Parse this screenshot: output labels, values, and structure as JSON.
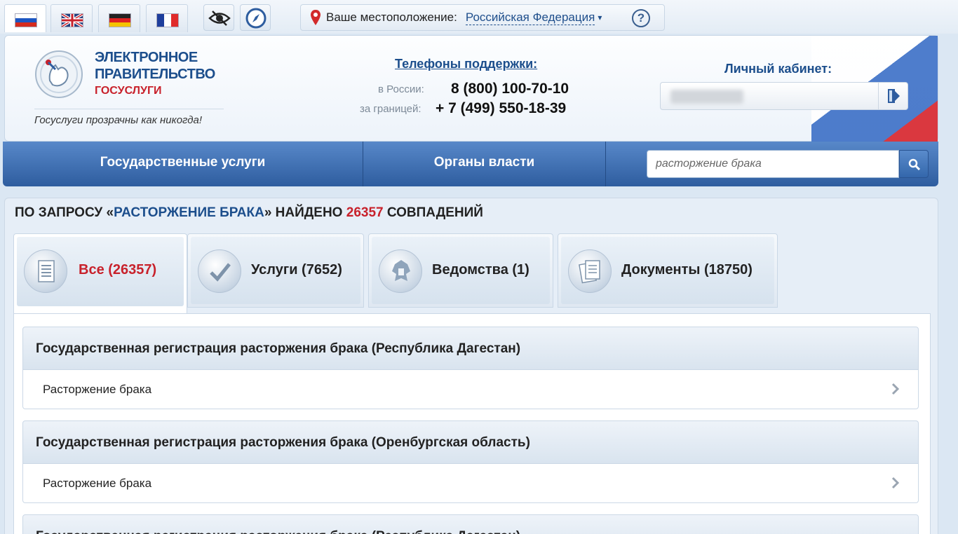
{
  "languages": [
    {
      "name": "ru",
      "active": true
    },
    {
      "name": "en",
      "active": false
    },
    {
      "name": "de",
      "active": false
    },
    {
      "name": "fr",
      "active": false
    }
  ],
  "location": {
    "label": "Ваше местоположение:",
    "value": "Российская Федерация",
    "help": "?"
  },
  "header": {
    "logo_line1": "ЭЛЕКТРОННОЕ",
    "logo_line2": "ПРАВИТЕЛЬСТВО",
    "logo_line3": "ГОСУСЛУГИ",
    "slogan": "Госуслуги прозрачны как никогда!",
    "support_title": "Телефоны поддержки:",
    "phones": [
      {
        "label": "в России:",
        "number": "8 (800) 100-70-10"
      },
      {
        "label": "за границей:",
        "number": "+ 7 (499) 550-18-39"
      }
    ],
    "cabinet_title": "Личный кабинет:"
  },
  "nav": {
    "items": [
      "Государственные услуги",
      "Органы власти"
    ],
    "search_value": "расторжение брака"
  },
  "results": {
    "prefix": "ПО ЗАПРОСУ «",
    "query": "РАСТОРЖЕНИЕ БРАКА",
    "middle": "» НАЙДЕНО ",
    "count": "26357",
    "suffix": " СОВПАДЕНИЙ"
  },
  "tabs": [
    {
      "label": "Все (26357)",
      "icon": "list-icon",
      "active": true
    },
    {
      "label": "Услуги (7652)",
      "icon": "checkmark-icon",
      "active": false
    },
    {
      "label": "Ведомства (1)",
      "icon": "coat-of-arms-icon",
      "active": false
    },
    {
      "label": "Документы (18750)",
      "icon": "documents-icon",
      "active": false
    }
  ],
  "groups": [
    {
      "title": "Государственная регистрация расторжения брака (Республика Дагестан)",
      "item": "Расторжение брака"
    },
    {
      "title": "Государственная регистрация расторжения брака (Оренбургская область)",
      "item": "Расторжение брака"
    },
    {
      "title": "Государственная регистрация расторжения брака (Республика Дагестан)",
      "item": ""
    }
  ],
  "colors": {
    "brand_blue": "#1c4e8c",
    "accent_red": "#c8212b",
    "nav_blue": "#3a6aae"
  }
}
